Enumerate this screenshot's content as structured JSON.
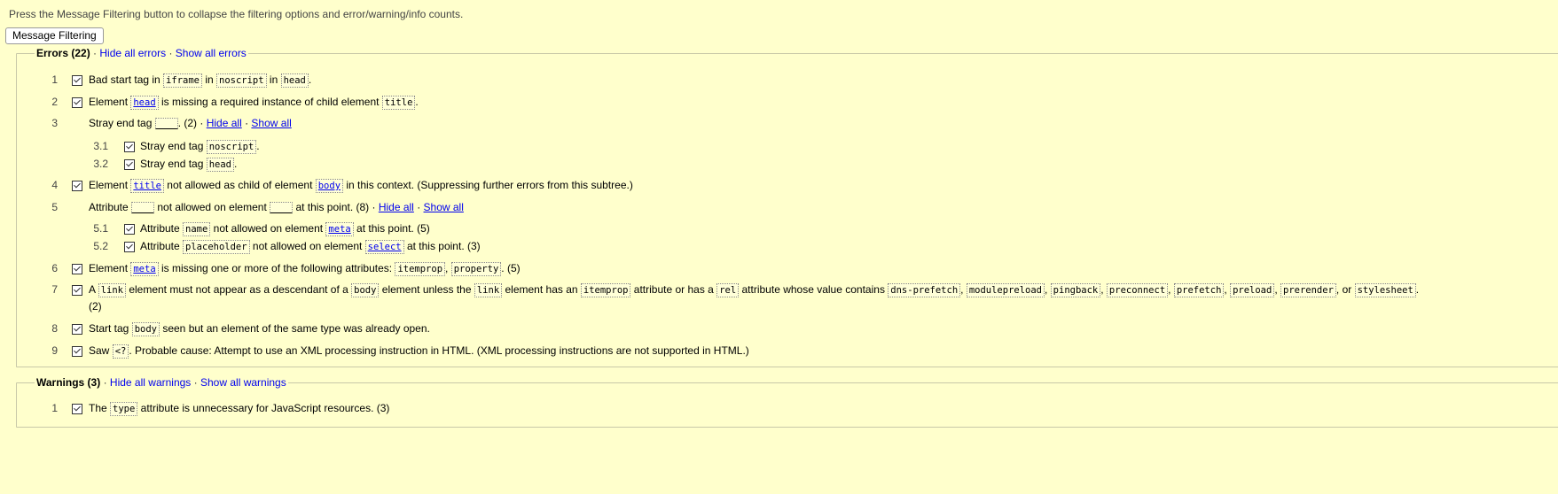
{
  "hint_text": "Press the Message Filtering button to collapse the filtering options and error/warning/info counts.",
  "filter_button": "Message Filtering",
  "errors": {
    "title": "Errors (22)",
    "sep": "·",
    "hide_all": "Hide all errors",
    "show_all": "Show all errors",
    "items": [
      {
        "num": "1",
        "parts": [
          "Bad start tag in ",
          "iframe",
          " in ",
          "noscript",
          " in ",
          "head",
          "."
        ]
      },
      {
        "num": "2",
        "parts": [
          "Element ",
          "head",
          " is missing a required instance of child element ",
          "title",
          "."
        ]
      },
      {
        "num": "3",
        "text": "Stray end tag",
        "count": "(2)",
        "hide": "Hide all",
        "show": "Show all"
      },
      {
        "num": "3.1",
        "parts": [
          "Stray end tag ",
          "noscript",
          "."
        ]
      },
      {
        "num": "3.2",
        "parts": [
          "Stray end tag ",
          "head",
          "."
        ]
      },
      {
        "num": "4",
        "parts": [
          "Element ",
          "title",
          " not allowed as child of element ",
          "body",
          " in this context. (Suppressing further errors from this subtree.)"
        ]
      },
      {
        "num": "5",
        "text_a": "Attribute",
        "text_b": "not allowed on element",
        "text_c": "at this point. (8)",
        "hide": "Hide all",
        "show": "Show all"
      },
      {
        "num": "5.1",
        "parts": [
          "Attribute ",
          "name",
          " not allowed on element ",
          "meta",
          " at this point. (5)"
        ]
      },
      {
        "num": "5.2",
        "parts": [
          "Attribute ",
          "placeholder",
          " not allowed on element ",
          "select",
          " at this point. (3)"
        ]
      },
      {
        "num": "6",
        "parts": [
          "Element ",
          "meta",
          " is missing one or more of the following attributes: ",
          "itemprop",
          ", ",
          "property",
          ". (5)"
        ]
      },
      {
        "num": "7",
        "parts": [
          "A ",
          "link",
          " element must not appear as a descendant of a ",
          "body",
          " element unless the ",
          "link",
          " element has an ",
          "itemprop",
          " attribute or has a ",
          "rel",
          " attribute whose value contains ",
          "dns-prefetch",
          ", ",
          "modulepreload",
          ", ",
          "pingback",
          ", ",
          "preconnect",
          ", ",
          "prefetch",
          ", ",
          "preload",
          ", ",
          "prerender",
          ", or ",
          "stylesheet",
          "."
        ],
        "cont": "(2)"
      },
      {
        "num": "8",
        "parts": [
          "Start tag ",
          "body",
          " seen but an element of the same type was already open."
        ]
      },
      {
        "num": "9",
        "parts": [
          "Saw ",
          "<?",
          ". Probable cause: Attempt to use an XML processing instruction in HTML. (XML processing instructions are not supported in HTML.)"
        ]
      }
    ]
  },
  "warnings": {
    "title": "Warnings (3)",
    "sep": "·",
    "hide_all": "Hide all warnings",
    "show_all": "Show all warnings",
    "items": [
      {
        "num": "1",
        "parts": [
          "The ",
          "type",
          " attribute is unnecessary for JavaScript resources. (3)"
        ]
      }
    ]
  }
}
